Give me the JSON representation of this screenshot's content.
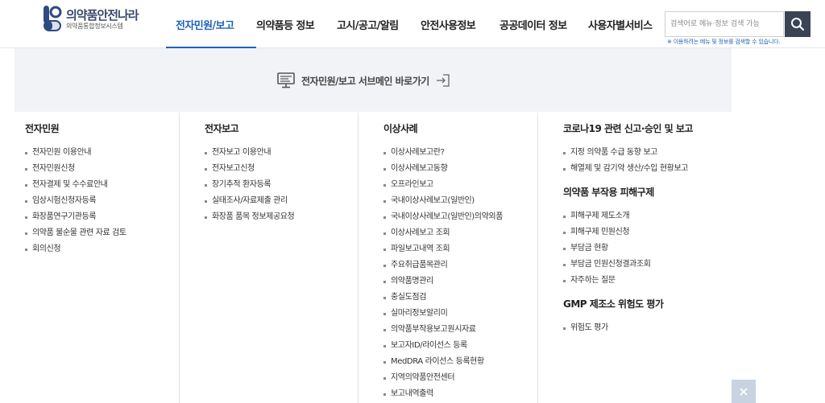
{
  "brand": {
    "title": "의약품안전나라",
    "subtitle": "의약품통합정보시스템"
  },
  "nav": [
    {
      "label": "전자민원/보고",
      "active": true
    },
    {
      "label": "의약품등 정보",
      "active": false
    },
    {
      "label": "고시/공고/알림",
      "active": false
    },
    {
      "label": "안전사용정보",
      "active": false
    },
    {
      "label": "공공데이터 정보",
      "active": false
    },
    {
      "label": "사용자별서비스",
      "active": false
    }
  ],
  "search": {
    "placeholder": "검색어로 메뉴·정보 검색 가능",
    "value": "",
    "note": "※ 이용하려는 메뉴 및 정보를 검색할 수 있습니다."
  },
  "banner": {
    "label": "전자민원/보고 서브메인 바로가기"
  },
  "columns": [
    {
      "groups": [
        {
          "title": "전자민원",
          "items": [
            "전자민원 이용안내",
            "전자민원신청",
            "전자결제 및 수수료안내",
            "임상시험신청자등록",
            "화장품연구기관등록",
            "의약품 불순물 관련 자료 검토",
            "회의신청"
          ]
        }
      ]
    },
    {
      "groups": [
        {
          "title": "전자보고",
          "items": [
            "전자보고 이용안내",
            "전자보고신청",
            "장기추적 환자등록",
            "실태조사/자료제출 관리",
            "화장품 품목 정보제공요청"
          ]
        }
      ]
    },
    {
      "groups": [
        {
          "title": "이상사례",
          "items": [
            "이상사례보고란?",
            "이상사례보고동향",
            "오프라인보고",
            "국내이상사례보고(일반인)",
            "국내이상사례보고(일반인)의약외품",
            "이상사례보고 조회",
            "파일보고내역 조회",
            "주요취급품목관리",
            "의약품명관리",
            "충실도점검",
            "실마리정보알리미",
            "의약품부작용보고원시자료",
            "보고자ID/라이선스 등록",
            "MedDRA 라이선스 등록현황",
            "지역의약품안전센터",
            "보고내역출력"
          ]
        }
      ]
    },
    {
      "groups": [
        {
          "title": "코로나19 관련 신고·승인 및 보고",
          "items": [
            "지정 의약품 수급 동향 보고",
            "해열제 및 감기약 생산/수입 현황보고"
          ]
        },
        {
          "title": "의약품 부작용 피해구제",
          "items": [
            "피해구제 제도소개",
            "피해구제 민원신청",
            "부담금 현황",
            "부담금 민원신청결과조회",
            "자주하는 질문"
          ]
        },
        {
          "title": "GMP 제조소 위험도 평가",
          "items": [
            "위험도 평가"
          ]
        }
      ]
    }
  ],
  "icons": {
    "search": "search-icon",
    "banner": "monitor-icon",
    "banner_arrow": "arrow-right-box-icon",
    "close": "close-icon"
  },
  "colors": {
    "accent": "#1d62b8",
    "search_button": "#3a4454",
    "banner_bg": "#f1f3f6",
    "close_button": "#c7d3e1"
  }
}
